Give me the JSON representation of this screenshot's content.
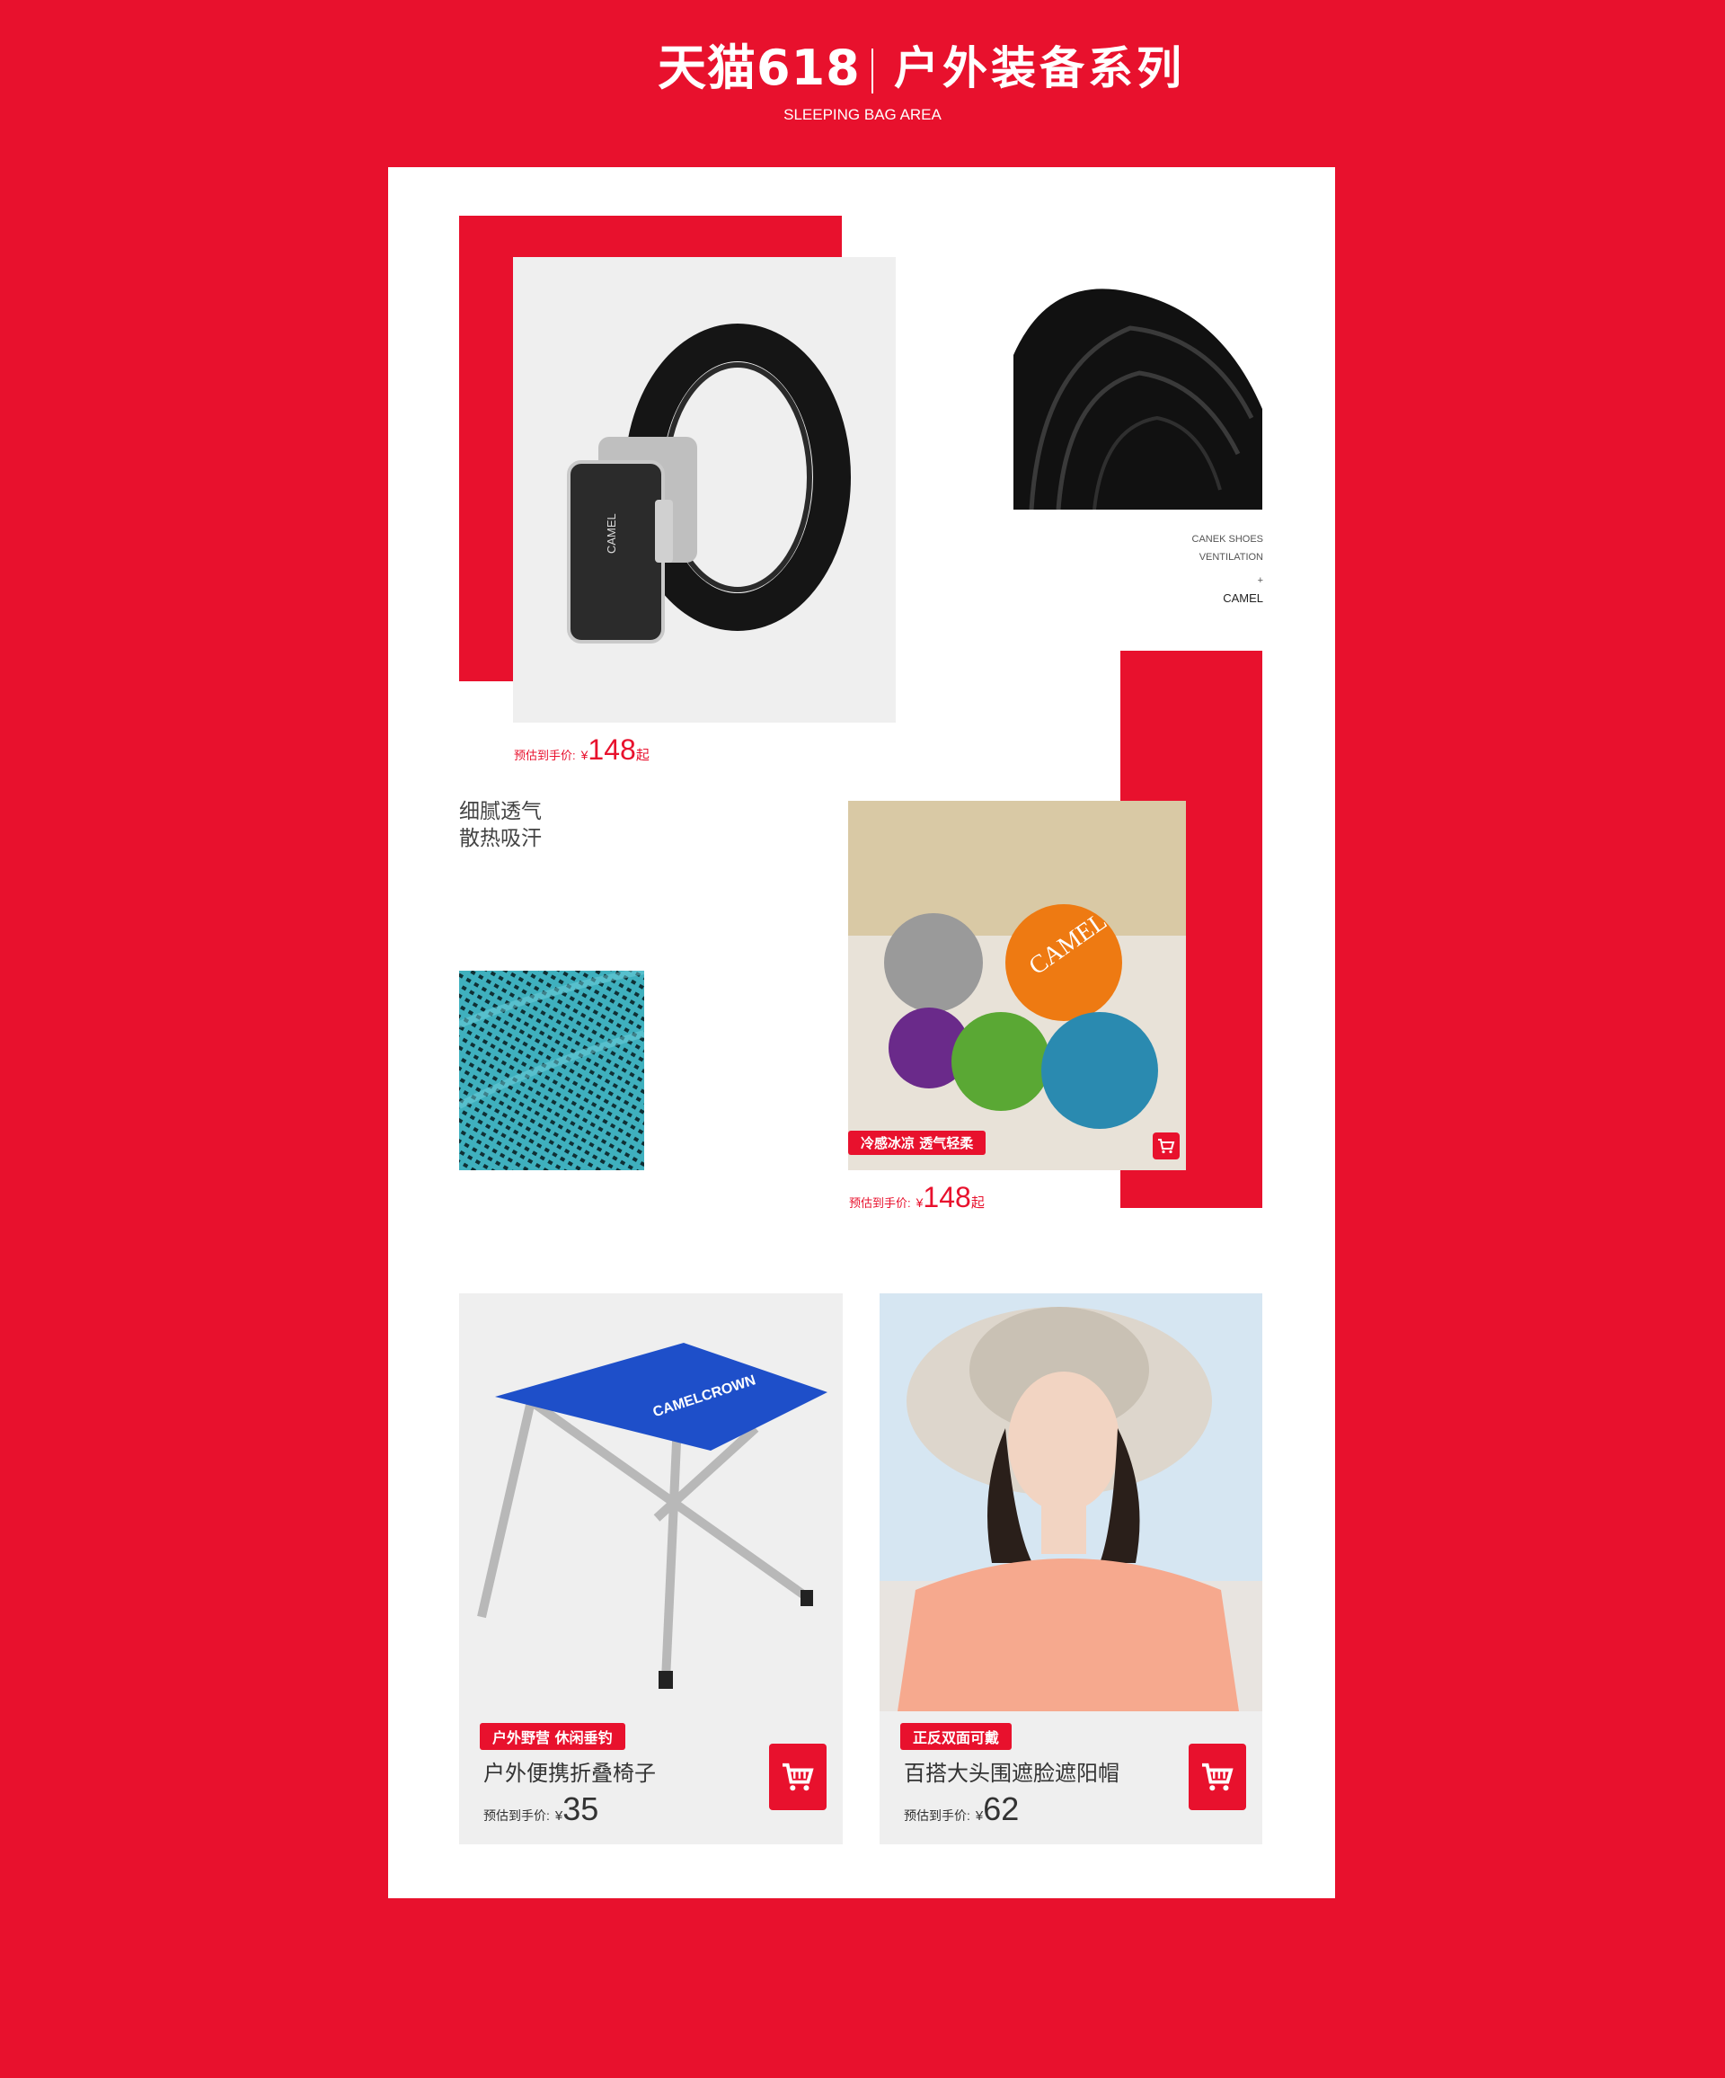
{
  "header": {
    "brand": "天猫618",
    "title": "户外装备系列",
    "subtitle": "SLEEPING BAG AREA"
  },
  "belt": {
    "logo_text": "CAMEL",
    "price_label": "预估到手价:",
    "currency": "¥",
    "price": "148",
    "price_suffix": "起"
  },
  "belt_detail": {
    "caption_line1": "CANEK SHOES",
    "caption_line2": "VENTILATION",
    "plus": "+",
    "brand": "CAMEL"
  },
  "features": {
    "line1": "细腻透气",
    "line2": "散热吸汗"
  },
  "towel": {
    "tag": "冷感冰凉  透气轻柔",
    "logo_text": "CAMEL",
    "price_label": "预估到手价:",
    "currency": "¥",
    "price": "148",
    "price_suffix": "起"
  },
  "products": [
    {
      "logo_text": "CAMELCROWN",
      "tag": "户外野营 休闲垂钓",
      "name": "户外便携折叠椅子",
      "price_label": "预估到手价:",
      "currency": "¥",
      "price": "35"
    },
    {
      "tag": "正反双面可戴",
      "name": "百搭大头围遮脸遮阳帽",
      "price_label": "预估到手价:",
      "currency": "¥",
      "price": "62"
    }
  ],
  "colors": {
    "brand_red": "#e8112d",
    "panel_white": "#ffffff",
    "card_grey": "#efefef"
  }
}
